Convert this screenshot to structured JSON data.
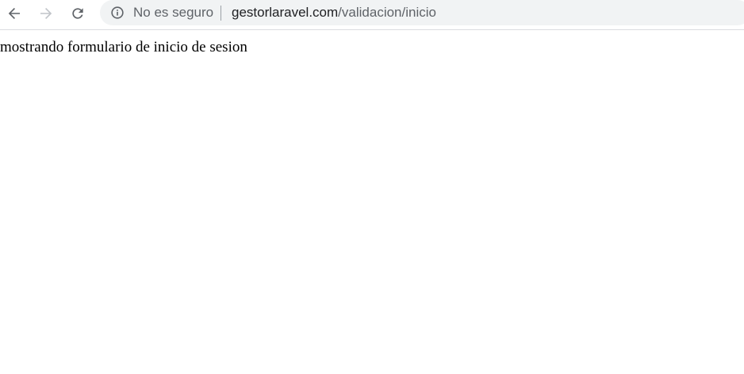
{
  "toolbar": {
    "back_icon": "back-arrow-icon",
    "forward_icon": "forward-arrow-icon",
    "reload_icon": "reload-icon",
    "omnibox": {
      "info_icon": "info-icon",
      "security_label": "No es seguro",
      "url_host": "gestorlaravel.com",
      "url_path": "/validacion/inicio"
    }
  },
  "page": {
    "body_text": "mostrando formulario de inicio de sesion"
  },
  "colors": {
    "icon_active": "#5f6368",
    "icon_disabled": "#c1c4c9",
    "omnibox_bg": "#f1f3f4",
    "url_host": "#202124",
    "url_path": "#5f6368"
  }
}
